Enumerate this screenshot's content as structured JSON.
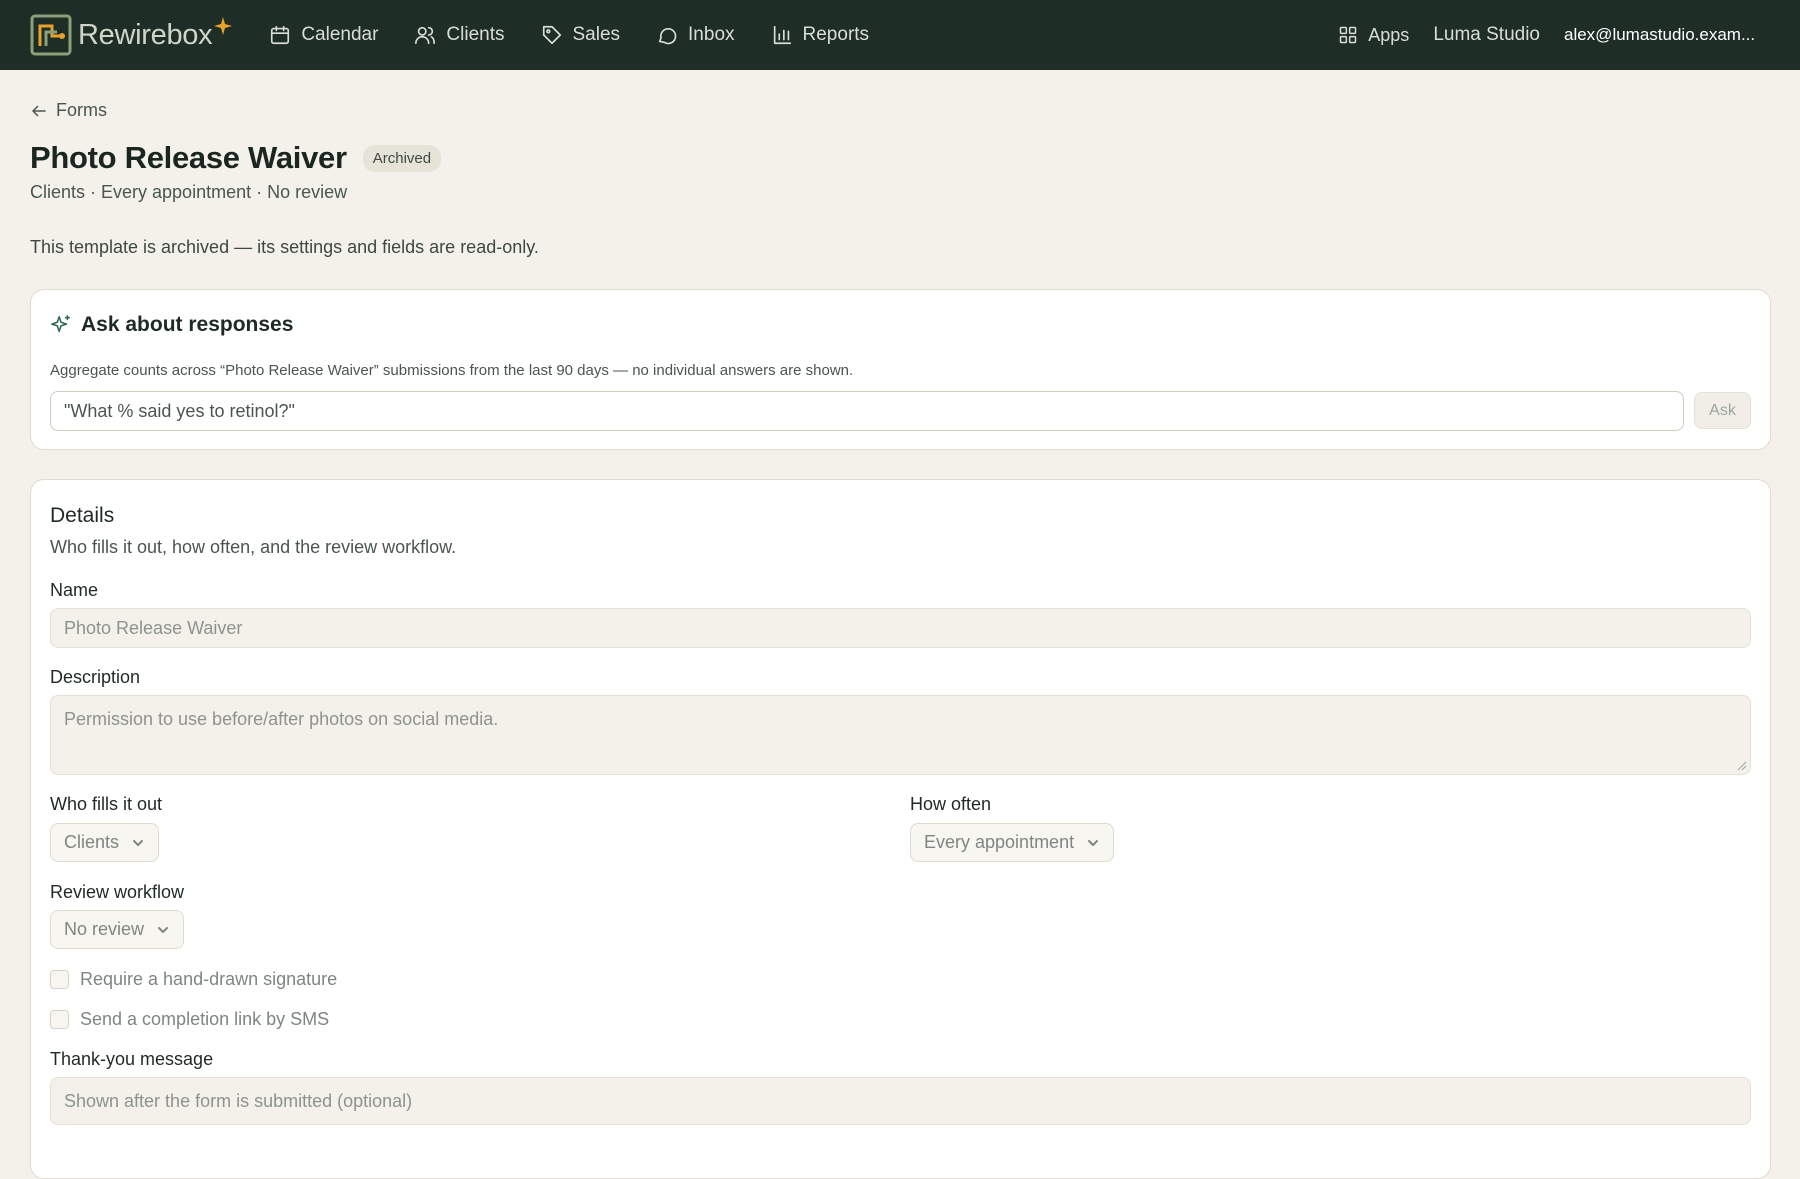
{
  "topbar": {
    "brand": "Rewirebox",
    "nav": [
      {
        "label": "Calendar",
        "icon": "calendar-icon"
      },
      {
        "label": "Clients",
        "icon": "users-icon"
      },
      {
        "label": "Sales",
        "icon": "tag-icon"
      },
      {
        "label": "Inbox",
        "icon": "chat-icon"
      },
      {
        "label": "Reports",
        "icon": "bar-chart-icon"
      }
    ],
    "apps_label": "Apps",
    "org": "Luma Studio",
    "user_email": "alex@lumastudio.exam..."
  },
  "header": {
    "back_label": "Forms",
    "title": "Photo Release Waiver",
    "status_badge": "Archived",
    "subtitle": "Clients · Every appointment · No review",
    "notice": "This template is archived — its settings and fields are read-only."
  },
  "ask": {
    "title": "Ask about responses",
    "description": "Aggregate counts across “Photo Release Waiver” submissions from the last 90 days — no individual answers are shown.",
    "placeholder": "\"What % said yes to retinol?\"",
    "button": "Ask"
  },
  "details": {
    "title": "Details",
    "description": "Who fills it out, how often, and the review workflow.",
    "name_label": "Name",
    "name_value": "Photo Release Waiver",
    "description_label": "Description",
    "description_value": "Permission to use before/after photos on social media.",
    "who_label": "Who fills it out",
    "who_value": "Clients",
    "how_often_label": "How often",
    "how_often_value": "Every appointment",
    "review_label": "Review workflow",
    "review_value": "No review",
    "signature_label": "Require a hand-drawn signature",
    "sms_label": "Send a completion link by SMS",
    "thankyou_label": "Thank-you message",
    "thankyou_placeholder": "Shown after the form is submitted (optional)"
  },
  "colors": {
    "topbar_bg": "#1f2d27",
    "page_bg": "#f3f1ea",
    "accent": "#2f6b54",
    "brand_star": "#e8a12b"
  }
}
